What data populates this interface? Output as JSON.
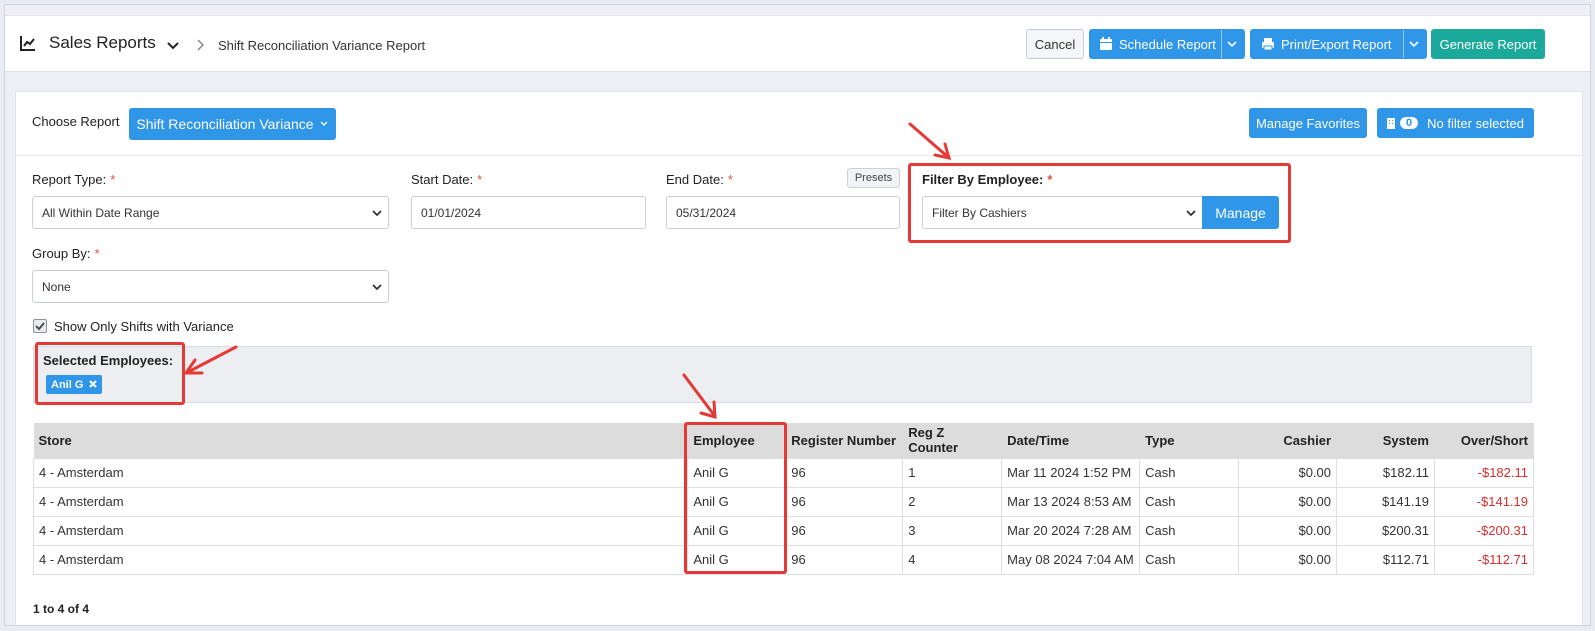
{
  "header": {
    "title": "Sales Reports",
    "breadcrumb_current": "Shift Reconciliation Variance Report",
    "buttons": {
      "cancel": "Cancel",
      "schedule": "Schedule Report",
      "print_export": "Print/Export Report",
      "generate": "Generate Report"
    }
  },
  "report": {
    "choose_label": "Choose Report",
    "choose_value": "Shift Reconciliation Variance",
    "manage_favorites": "Manage Favorites",
    "filter_count": "0",
    "filter_status": "No filter selected"
  },
  "form": {
    "report_type_label": "Report Type:",
    "report_type_value": "All Within Date Range",
    "start_date_label": "Start Date:",
    "start_date_value": "01/01/2024",
    "end_date_label": "End Date:",
    "end_date_value": "05/31/2024",
    "presets": "Presets",
    "filter_employee_label": "Filter By Employee:",
    "filter_employee_value": "Filter By Cashiers",
    "manage": "Manage",
    "group_by_label": "Group By:",
    "group_by_value": "None",
    "variance_checkbox_label": "Show Only Shifts with Variance",
    "required_mark": "*"
  },
  "selected_employees": {
    "label": "Selected Employees:",
    "chips": [
      "Anil G"
    ]
  },
  "table": {
    "columns": [
      "Store",
      "Employee",
      "Register Number",
      "Reg Z Counter",
      "Date/Time",
      "Type",
      "Cashier",
      "System",
      "Over/Short"
    ],
    "rows": [
      [
        "4 - Amsterdam",
        "Anil G",
        "96",
        "1",
        "Mar 11 2024 1:52 PM",
        "Cash",
        "$0.00",
        "$182.11",
        "-$182.11"
      ],
      [
        "4 - Amsterdam",
        "Anil G",
        "96",
        "2",
        "Mar 13 2024 8:53 AM",
        "Cash",
        "$0.00",
        "$141.19",
        "-$141.19"
      ],
      [
        "4 - Amsterdam",
        "Anil G",
        "96",
        "3",
        "Mar 20 2024 7:28 AM",
        "Cash",
        "$0.00",
        "$200.31",
        "-$200.31"
      ],
      [
        "4 - Amsterdam",
        "Anil G",
        "96",
        "4",
        "May 08 2024 7:04 AM",
        "Cash",
        "$0.00",
        "$112.71",
        "-$112.71"
      ]
    ],
    "pager": "1 to 4 of 4"
  },
  "colors": {
    "primary": "#2f96e8",
    "generate": "#1aa99a",
    "negative": "#d32f2f",
    "annotation": "#e53935"
  }
}
